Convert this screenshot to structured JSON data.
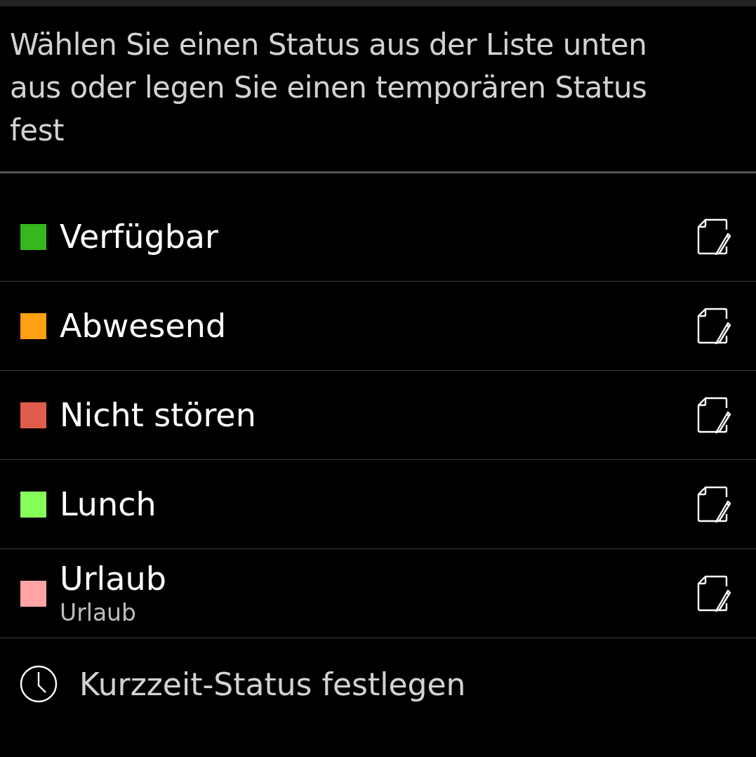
{
  "prompt": "Wählen Sie einen Status aus der Liste unten aus oder legen Sie einen temporären Status fest",
  "statuses": [
    {
      "name": "Verfügbar",
      "color": "#34b81c"
    },
    {
      "name": "Abwesend",
      "color": "#ff9f12"
    },
    {
      "name": "Nicht stören",
      "color": "#e15d4b"
    },
    {
      "name": "Lunch",
      "color": "#87ff5a"
    },
    {
      "name": "Urlaub",
      "subtitle": "Urlaub",
      "color": "#ffa3a3"
    }
  ],
  "temporary_action": {
    "label": "Kurzzeit-Status festlegen"
  }
}
